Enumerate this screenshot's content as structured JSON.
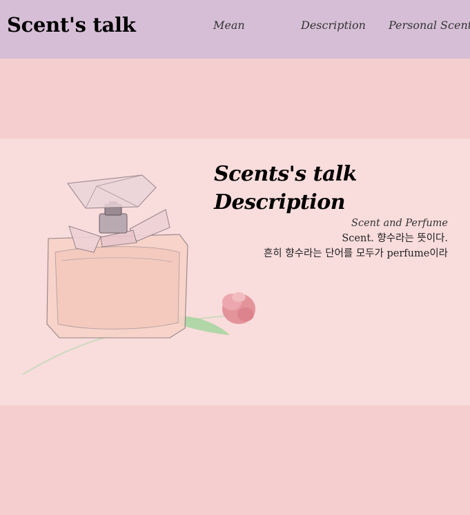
{
  "header": {
    "brand": "Scent's talk",
    "nav": [
      "Mean",
      "Description",
      "Personal Scent"
    ]
  },
  "hero": {
    "title_line1": "Scents's talk",
    "title_line2": "Description",
    "subtitle": "Scent and Perfume",
    "text_line1": "Scent. 향수라는 뜻이다.",
    "text_line2": "흔히 향수라는 단어를 모두가 perfume이라"
  },
  "colors": {
    "header_bg": "#d6bfd6",
    "page_bg": "#f5cfcf",
    "hero_bg": "#f9dcdc"
  },
  "icons": {
    "illustration": "perfume-bottle-with-rose-illustration"
  }
}
